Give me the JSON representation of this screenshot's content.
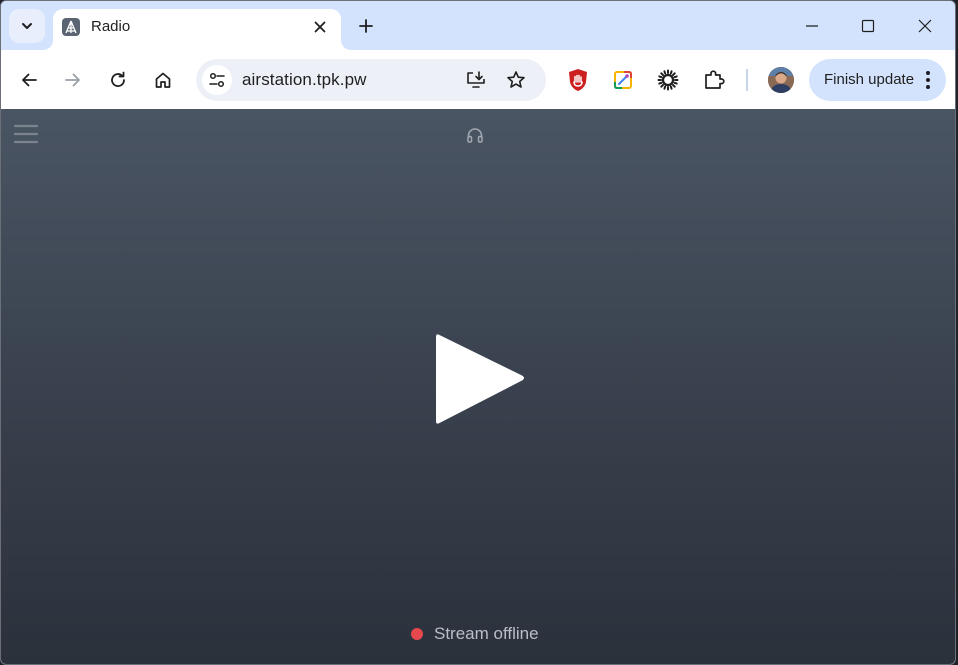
{
  "browser": {
    "tab": {
      "title": "Radio",
      "favicon": "airstation-logo-icon",
      "close_icon": "close-icon"
    },
    "tab_search_icon": "chevron-down-icon",
    "new_tab_icon": "plus-icon",
    "window_controls": [
      "minimize-icon",
      "maximize-icon",
      "close-icon"
    ],
    "toolbar": {
      "back_icon": "arrow-left-icon",
      "forward_icon": "arrow-right-icon",
      "reload_icon": "reload-icon",
      "home_icon": "home-icon",
      "site_info_icon": "tune-icon",
      "url": "airstation.tpk.pw",
      "install_app_icon": "install-app-icon",
      "bookmark_icon": "star-icon",
      "extensions": [
        "ublock-origin-icon",
        "color-picker-icon",
        "sunburst-extension-icon",
        "puzzle-piece-icon"
      ],
      "profile_icon": "avatar",
      "update_label": "Finish update",
      "menu_icon": "more-vertical-icon"
    },
    "colors": {
      "tabstrip": "#d3e3fd",
      "toolbar": "#ffffff",
      "omnibox": "#edf1f7",
      "update_button": "#d3e3fd"
    }
  },
  "page": {
    "menu_icon": "hamburger-icon",
    "header_icon": "headphones-icon",
    "play_icon": "play-icon",
    "stream_status": {
      "text": "Stream offline",
      "color": "#e5484d"
    },
    "colors": {
      "background_top": "#4a5563",
      "background_bottom": "#2b313b"
    }
  }
}
